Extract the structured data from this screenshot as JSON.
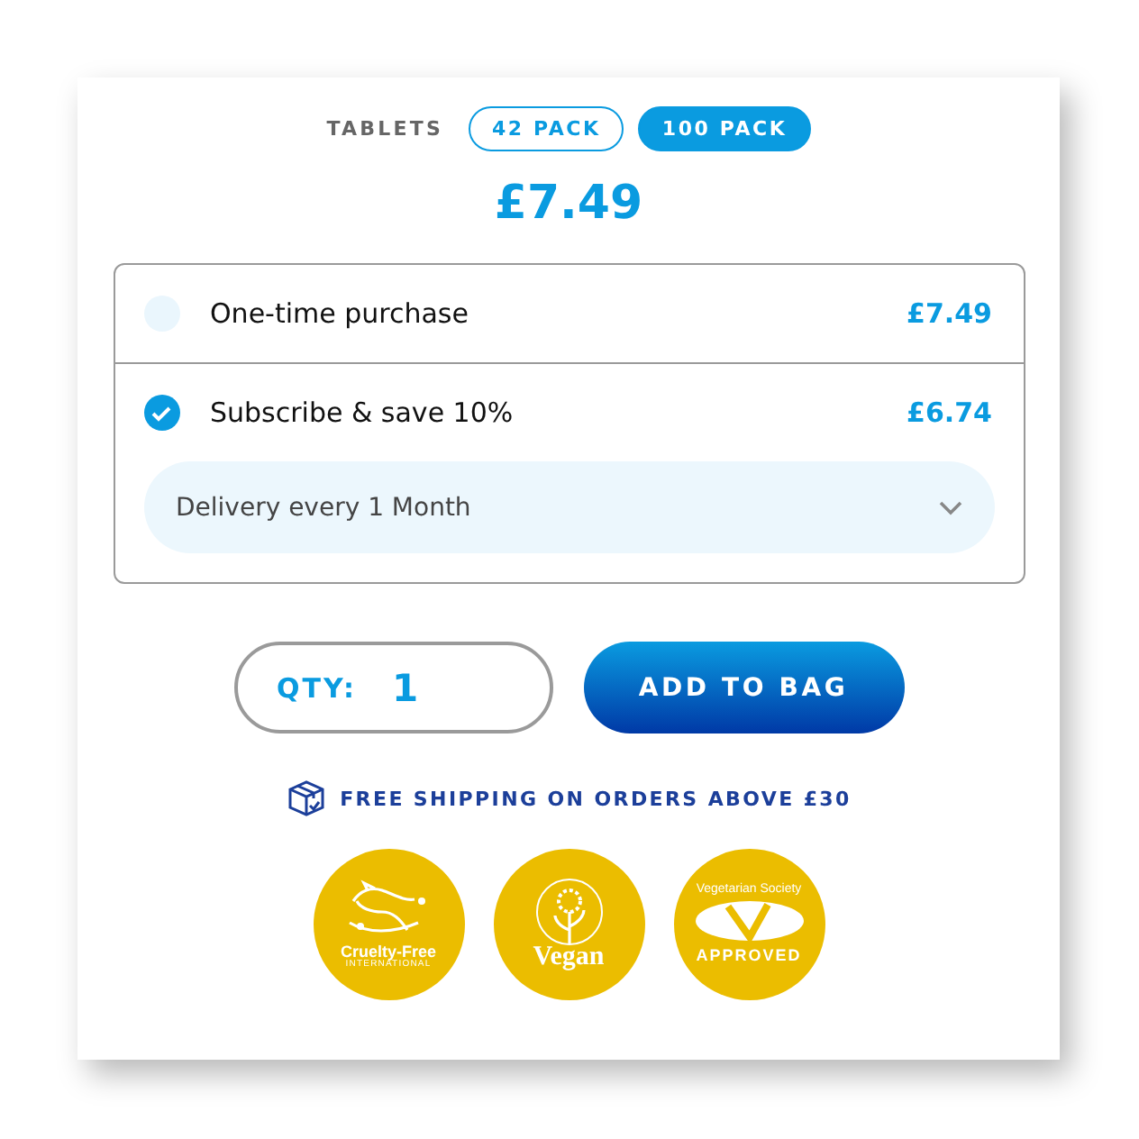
{
  "pack_selector": {
    "label": "TABLETS",
    "options": [
      {
        "label": "42 PACK",
        "selected": false
      },
      {
        "label": "100 PACK",
        "selected": true
      }
    ]
  },
  "price": "£7.49",
  "purchase_options": [
    {
      "label": "One-time purchase",
      "price": "£7.49",
      "selected": false
    },
    {
      "label": "Subscribe & save 10%",
      "price": "£6.74",
      "selected": true
    }
  ],
  "delivery_select": {
    "value": "Delivery every 1 Month"
  },
  "quantity": {
    "label": "QTY:",
    "value": "1"
  },
  "add_button": "ADD TO BAG",
  "shipping_note": "FREE SHIPPING ON ORDERS ABOVE £30",
  "badges": [
    {
      "kind": "cruelty-free",
      "texts": [
        "Cruelty-Free",
        "INTERNATIONAL"
      ]
    },
    {
      "kind": "vegan",
      "texts": [
        "Vegan"
      ]
    },
    {
      "kind": "vegetarian",
      "texts": [
        "Vegetarian Society",
        "APPROVED"
      ]
    }
  ]
}
